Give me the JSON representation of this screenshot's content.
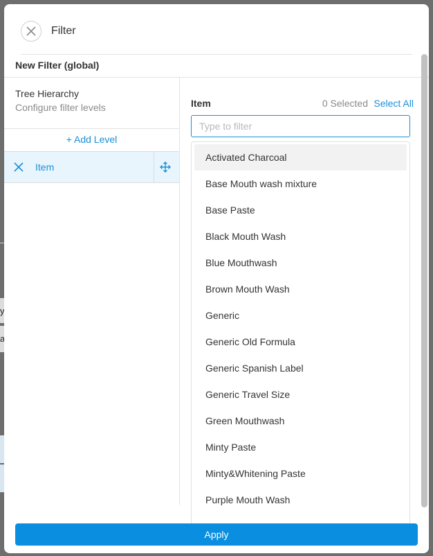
{
  "background": {
    "fragments": [
      "y",
      "a"
    ]
  },
  "modal": {
    "title": "Filter",
    "filter_name": "New Filter (global)"
  },
  "tree": {
    "title": "Tree Hierarchy",
    "subtitle": "Configure filter levels",
    "add_level_label": "+ Add Level",
    "levels": [
      {
        "label": "Item"
      }
    ]
  },
  "items_panel": {
    "title": "Item",
    "selected_text": "0 Selected",
    "select_all_label": "Select All",
    "search": {
      "value": "",
      "placeholder": "Type to filter"
    },
    "items": [
      "Activated Charcoal",
      "Base Mouth wash mixture",
      "Base Paste",
      "Black Mouth Wash",
      "Blue Mouthwash",
      "Brown Mouth Wash",
      "Generic",
      "Generic Old Formula",
      "Generic Spanish Label",
      "Generic Travel Size",
      "Green Mouthwash",
      "Minty Paste",
      "Minty&Whitening Paste",
      "Purple Mouth Wash"
    ]
  },
  "apply_label": "Apply",
  "icons": {
    "close": "close-icon",
    "remove_level": "close-icon",
    "drag": "move-icon"
  },
  "colors": {
    "accent": "#1a8fd8",
    "apply_button": "#0a8ee0",
    "selected_row": "#e8f5fd",
    "hover_item": "#f2f2f2",
    "overlay": "#6e6e6e"
  }
}
